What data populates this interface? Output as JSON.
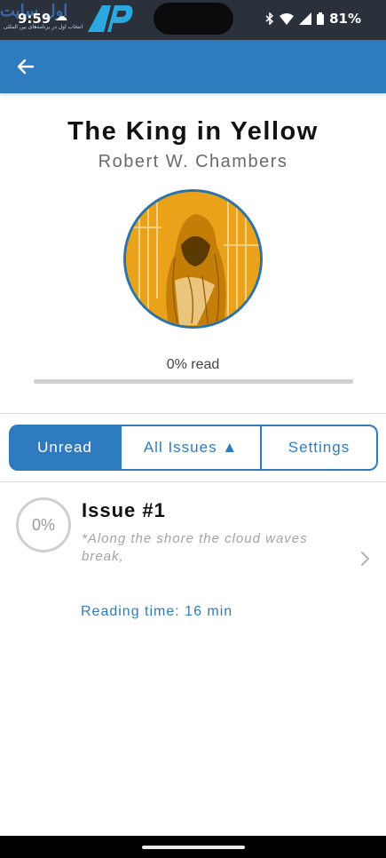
{
  "status_bar": {
    "time": "9:59",
    "battery": "81%",
    "watermark_text": "اول سایت",
    "watermark_sub": "انتخاب اول در برنامه‌های بین المللی"
  },
  "book": {
    "title": "The King in Yellow",
    "author": "Robert W. Chambers",
    "progress_label": "0% read",
    "progress_value": 0
  },
  "tabs": {
    "unread": "Unread",
    "all_issues": "All Issues ▲",
    "settings": "Settings"
  },
  "issues": [
    {
      "progress": "0%",
      "title": "Issue #1",
      "excerpt": "*Along the shore the cloud waves break,",
      "reading_time": "Reading time: 16 min"
    }
  ],
  "colors": {
    "accent": "#2f7bc0",
    "status_bar": "#2b313b",
    "cover": "#e9a21a"
  },
  "icons": {
    "back": "arrow-left",
    "chevron": "chevron-right"
  }
}
